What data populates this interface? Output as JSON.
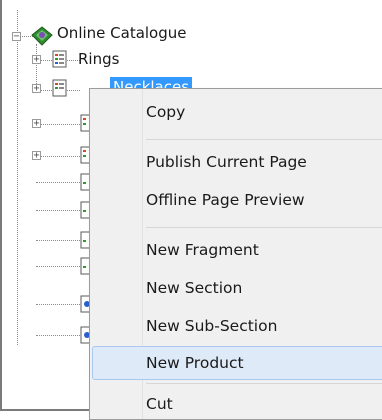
{
  "tree": {
    "root": {
      "label": "Online Catalogue",
      "expander": "−"
    },
    "children": [
      {
        "label": "Rings",
        "expander": "+"
      },
      {
        "label": "Necklaces",
        "expander": "+"
      }
    ],
    "collapsed_expander": "+"
  },
  "context_menu": {
    "items": [
      {
        "label": "Copy"
      },
      {
        "label": "Publish Current Page"
      },
      {
        "label": "Offline Page Preview"
      },
      {
        "label": "New Fragment"
      },
      {
        "label": "New Section"
      },
      {
        "label": "New Sub-Section"
      },
      {
        "label": "New Product",
        "hovered": true
      },
      {
        "label": "Cut"
      }
    ]
  },
  "colors": {
    "selection": "#3399ff",
    "menu_background": "#f0f0f0",
    "hover": "#dfeaf8"
  }
}
